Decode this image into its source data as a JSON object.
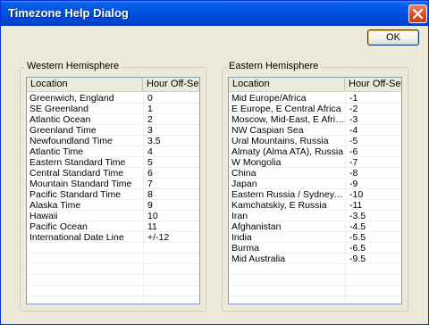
{
  "window": {
    "title": "Timezone Help Dialog"
  },
  "ok_button": {
    "label": "OK"
  },
  "west": {
    "legend": "Western Hemisphere",
    "columns": [
      "Location",
      "Hour Off-Set"
    ],
    "rows": [
      [
        "Greenwich, England",
        "0"
      ],
      [
        "SE Greenland",
        "1"
      ],
      [
        "Atlantic Ocean",
        "2"
      ],
      [
        "Greenland Time",
        "3"
      ],
      [
        "Newfoundland Time",
        "3.5"
      ],
      [
        "Atlantic Time",
        "4"
      ],
      [
        "Eastern Standard Time",
        "5"
      ],
      [
        "Central Standard Time",
        "6"
      ],
      [
        "Mountain Standard Time",
        "7"
      ],
      [
        "Pacific Standard Time",
        "8"
      ],
      [
        "Alaska Time",
        "9"
      ],
      [
        "Hawaii",
        "10"
      ],
      [
        "Pacific Ocean",
        "11"
      ],
      [
        "International Date Line",
        "+/-12"
      ]
    ]
  },
  "east": {
    "legend": "Eastern Hemisphere",
    "columns": [
      "Location",
      "Hour Off-Set"
    ],
    "rows": [
      [
        "Mid Europe/Africa",
        "-1"
      ],
      [
        "E Europe, E Central Africa",
        "-2"
      ],
      [
        "Moscow, Mid-East, E Africa",
        "-3"
      ],
      [
        "NW Caspian Sea",
        "-4"
      ],
      [
        "Ural Mountains, Russia",
        "-5"
      ],
      [
        "Almaty (Alma ATA), Russia",
        "-6"
      ],
      [
        "W Mongolia",
        "-7"
      ],
      [
        "China",
        "-8"
      ],
      [
        "Japan",
        "-9"
      ],
      [
        "Eastern Russia / Sydney, Austr...",
        "-10"
      ],
      [
        "Kamchatskiy, E Russia",
        "-11"
      ],
      [
        "Iran",
        "-3.5"
      ],
      [
        "Afghanistan",
        "-4.5"
      ],
      [
        "India",
        "-5.5"
      ],
      [
        "Burma",
        "-6.5"
      ],
      [
        "Mid Australia",
        "-9.5"
      ]
    ]
  }
}
